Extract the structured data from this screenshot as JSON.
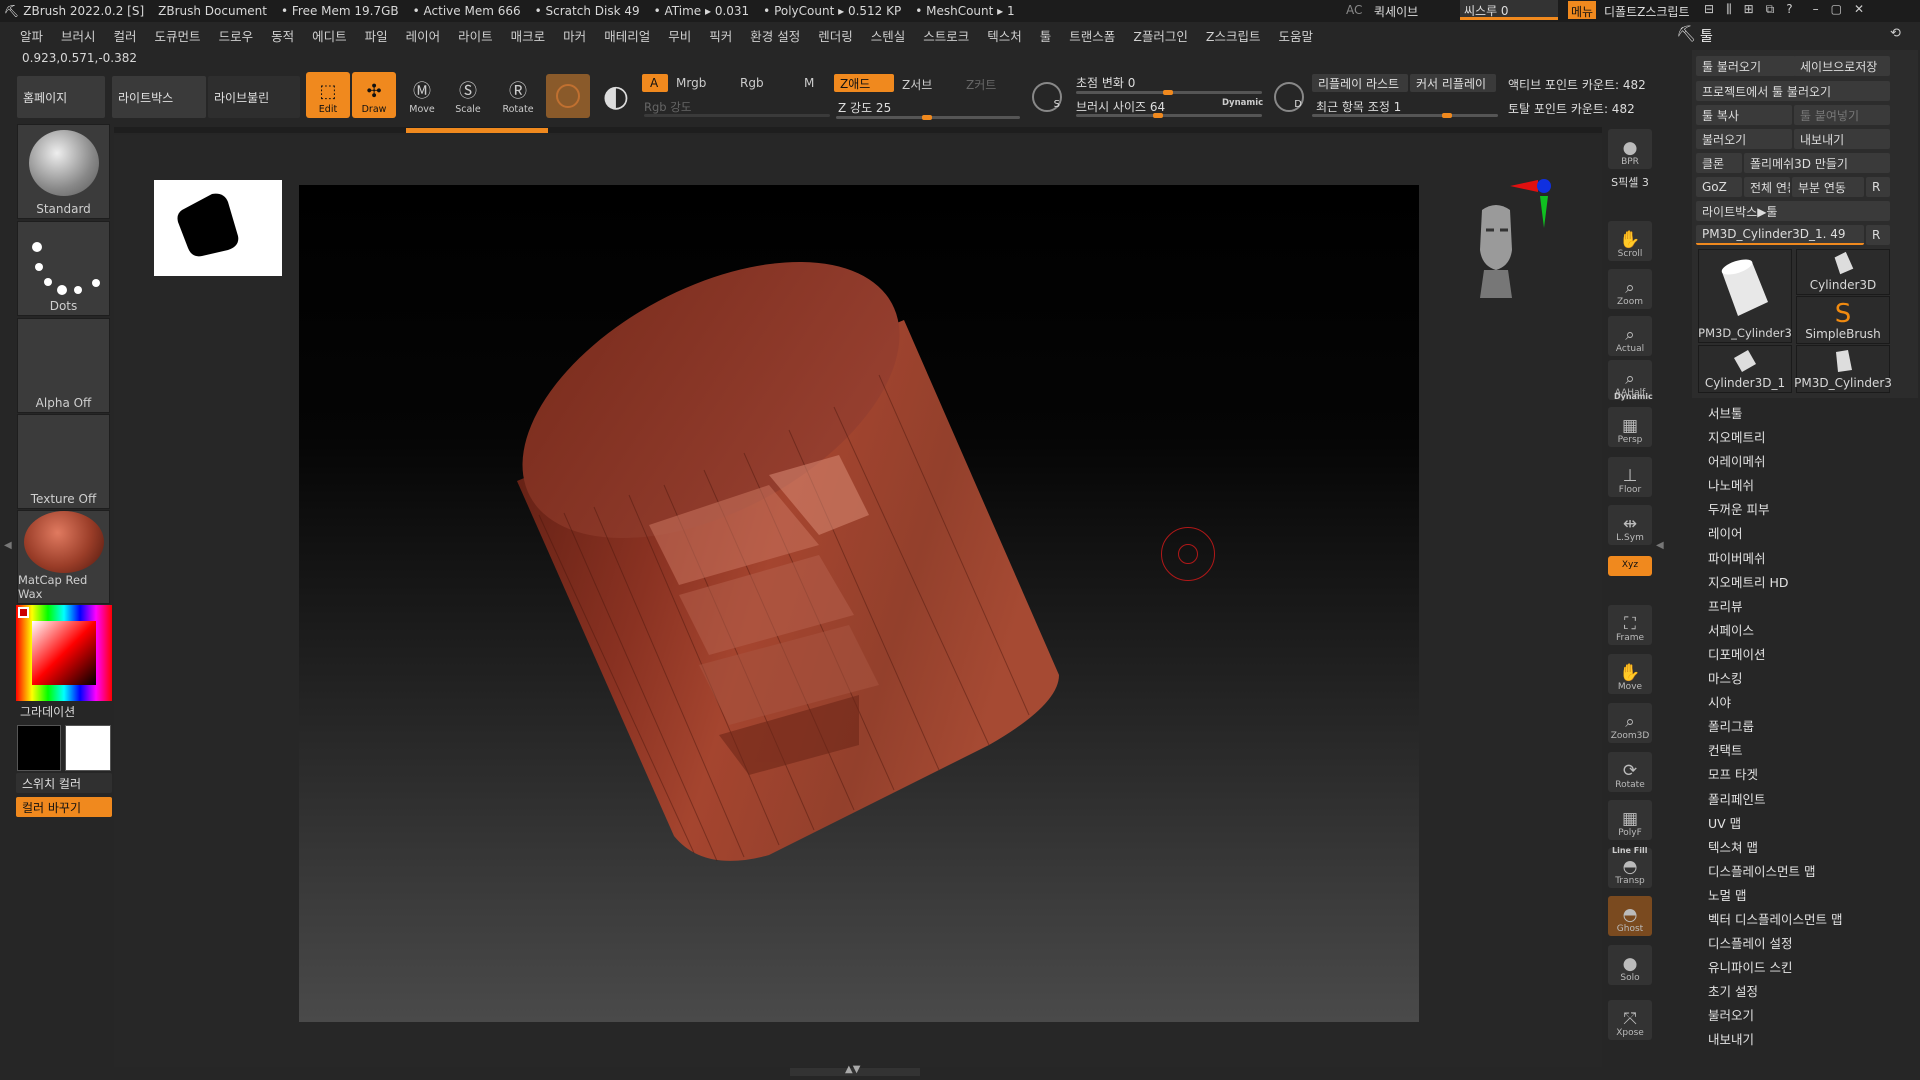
{
  "titlebar": {
    "app": "ZBrush 2022.0.2 [S]",
    "doc": "ZBrush Document",
    "free_mem": "• Free Mem 19.7GB",
    "active_mem": "• Active Mem 666",
    "scratch": "• Scratch Disk 49",
    "atime": "• ATime ▸ 0.031",
    "polycount": "• PolyCount ▸ 0.512 KP",
    "meshcount": "• MeshCount ▸ 1",
    "ac": "AC",
    "quicksave": "퀵세이브",
    "seethrough": "씨스루  0",
    "menu": "메뉴",
    "default_script": "디폴트Z스크립트"
  },
  "menubar": [
    "알파",
    "브러시",
    "컬러",
    "도큐먼트",
    "드로우",
    "동적",
    "에디트",
    "파일",
    "레이어",
    "라이트",
    "매크로",
    "마커",
    "매테리얼",
    "무비",
    "픽커",
    "환경 설정",
    "렌더링",
    "스텐실",
    "스트로크",
    "텍스처",
    "툴",
    "트랜스폼",
    "Z플러그인",
    "Z스크립트",
    "도움말"
  ],
  "coords": "0.923,0.571,-0.382",
  "toolbar": {
    "home": "홈페이지",
    "lightbox": "라이트박스",
    "livebool": "라이브불린",
    "edit": "Edit",
    "draw": "Draw",
    "move": "Move",
    "scale": "Scale",
    "rotate": "Rotate",
    "a": "A",
    "mrgb": "Mrgb",
    "rgb": "Rgb",
    "m": "M",
    "rgb_intensity": "Rgb 강도",
    "zadd": "Z애드",
    "zsub": "Z서브",
    "zcut": "Z커트",
    "z_intensity": "Z 강도  25",
    "focal": "초점 변화  0",
    "draw_size": "브러시 사이즈  64",
    "dynamic": "Dynamic",
    "replay_last": "리플레이 라스트",
    "cursor_replay": "커서 리플레이",
    "recent_adjust": "최근 항목 조정  1",
    "active_points": "액티브 포인트 카운트: 482",
    "total_points": "토탈 포인트 카운트: 482",
    "s": "S",
    "d": "D"
  },
  "left": {
    "brush": "Standard",
    "stroke": "Dots",
    "alpha": "Alpha Off",
    "texture": "Texture Off",
    "material": "MatCap Red Wax",
    "gradient": "그라데이션",
    "switch_color": "스위치 컬러",
    "swap_color": "컬러 바꾸기"
  },
  "right_shelf": [
    "BPR",
    "S픽셀 3",
    "Scroll",
    "Zoom",
    "Actual",
    "AAHalf",
    "Persp",
    "Floor",
    "L.Sym",
    "Xyz",
    "Frame",
    "Move",
    "Zoom3D",
    "Rotate",
    "PolyF",
    "Transp",
    "Ghost",
    "Solo",
    "Xpose"
  ],
  "right_shelf_extra": {
    "dynamic": "Dynamic",
    "linefill": "Line Fill"
  },
  "tool_panel": {
    "title": "툴",
    "load_tool": "툴 불러오기",
    "save_as": "세이브으로저장",
    "load_project": "프로젝트에서 툴 불러오기",
    "copy_tool": "툴 복사",
    "paste_tool": "툴 붙여넣기",
    "import": "불러오기",
    "export": "내보내기",
    "clone": "클론",
    "make_polymesh": "폴리메쉬3D 만들기",
    "goz": "GoZ",
    "all": "전체 연동",
    "visible": "부분 연동",
    "r": "R",
    "lightbox_tools": "라이트박스▶툴",
    "current_tool": "PM3D_Cylinder3D_1. 49",
    "thumbs": [
      "PM3D_Cylinder3",
      "Cylinder3D",
      "SimpleBrush",
      "Cylinder3D_1",
      "PM3D_Cylinder3"
    ],
    "sections": [
      "서브툴",
      "지오메트리",
      "어레이메쉬",
      "나노메쉬",
      "두꺼운 피부",
      "레이어",
      "파이버메쉬",
      "지오메트리 HD",
      "프리뷰",
      "서페이스",
      "디포메이션",
      "마스킹",
      "시야",
      "폴리그룹",
      "컨택트",
      "모프 타겟",
      "폴리페인트",
      "UV 맵",
      "텍스쳐 맵",
      "디스플레이스먼트 맵",
      "노멀 맵",
      "벡터 디스플레이스먼트 맵",
      "디스플레이 설정",
      "유니파이드 스킨",
      "초기 설정",
      "불러오기",
      "내보내기"
    ]
  },
  "colors": {
    "accent": "#f0891e",
    "model": "#9a4030",
    "canvas_top": "#000000",
    "canvas_bottom": "#4a4a4a"
  }
}
